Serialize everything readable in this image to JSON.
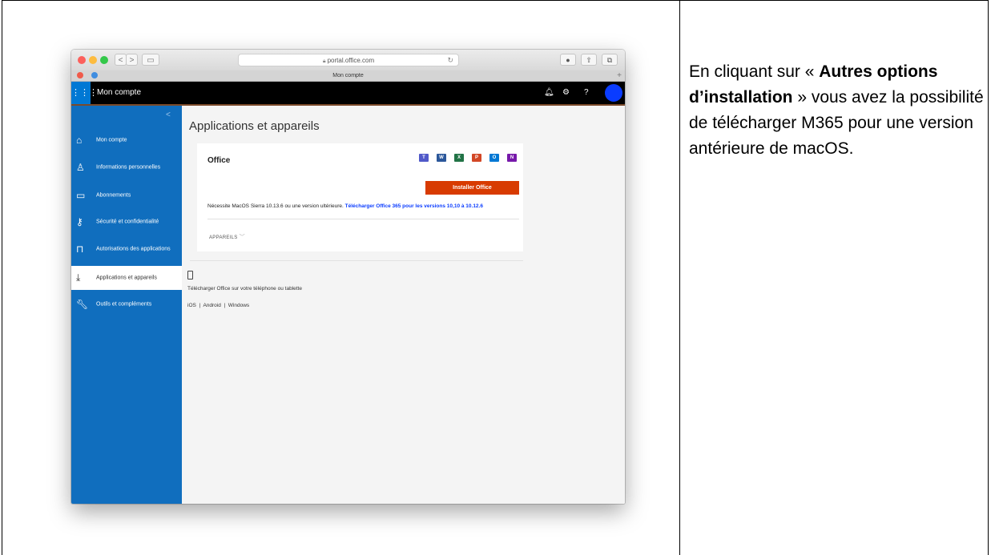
{
  "caption": {
    "part1": "En cliquant sur « ",
    "bold": "Autres options d’installation",
    "part2": " » vous avez la possibilité de télécharger M365 pour une version antérieure de macOS."
  },
  "browser": {
    "url": "portal.office.com",
    "tab_title": "Mon compte",
    "back": "<",
    "forward": ">"
  },
  "appbar": {
    "title": "Mon compte",
    "help": "?"
  },
  "sidebar": {
    "collapse": "<",
    "items": [
      {
        "label": "Mon compte",
        "icon": "home-icon"
      },
      {
        "label": "Informations personnelles",
        "icon": "person-icon"
      },
      {
        "label": "Abonnements",
        "icon": "card-icon"
      },
      {
        "label": "Sécurité et confidentialité",
        "icon": "key-icon"
      },
      {
        "label": "Autorisations des applications",
        "icon": "lock-icon"
      },
      {
        "label": "Applications et appareils",
        "icon": "download-icon"
      },
      {
        "label": "Outils et compléments",
        "icon": "wrench-icon"
      }
    ]
  },
  "main": {
    "title": "Applications et appareils",
    "office_card": {
      "title": "Office",
      "apps": [
        "T",
        "W",
        "X",
        "P",
        "O",
        "N"
      ],
      "install_button": "Installer Office",
      "requirement": "Nécessite MacOS Sierra 10.13.6 ou une version ultérieure.",
      "older_link": "Télécharger Office 365 pour les versions 10,10 à 10.12.6",
      "devices": "APPAREILS"
    },
    "mobile": {
      "text": "Télécharger Office sur votre téléphone ou tablette",
      "links": [
        "iOS",
        "Android",
        "Windows"
      ],
      "separator": "|"
    }
  },
  "colors": {
    "sidebar": "#106ebe",
    "install_button": "#d83b01",
    "link": "#0a3cff",
    "teams": "#5059c9",
    "word": "#2b579a",
    "excel": "#217346",
    "powerpoint": "#d24726",
    "outlook": "#0078d4",
    "onenote": "#7719aa"
  }
}
